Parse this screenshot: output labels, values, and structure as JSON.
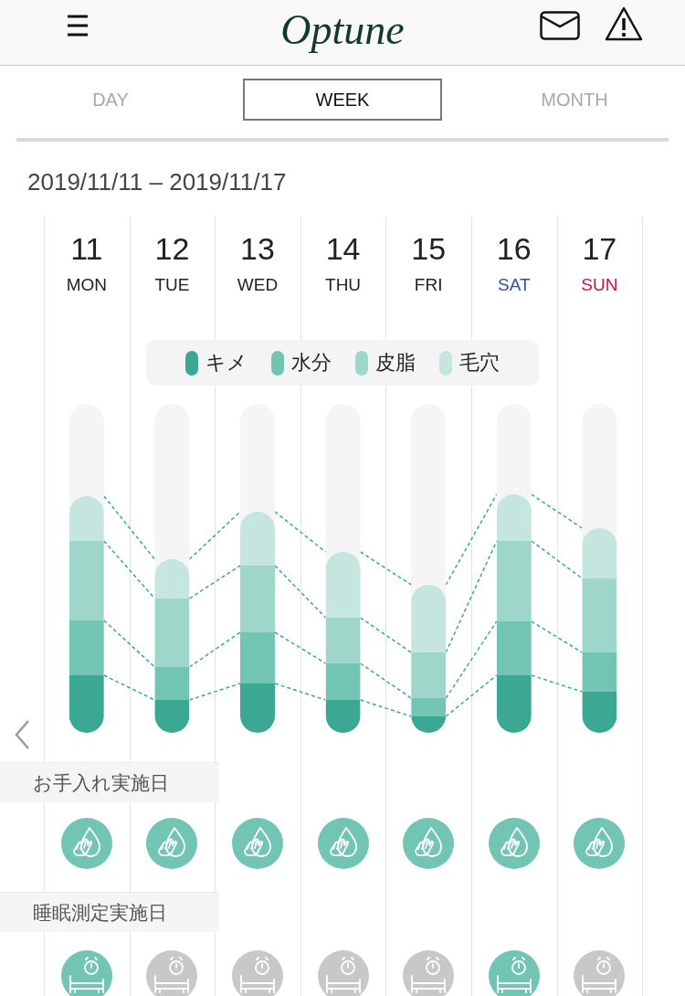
{
  "header": {
    "logo": "Optune"
  },
  "tabs": [
    {
      "label": "DAY",
      "selected": false
    },
    {
      "label": "WEEK",
      "selected": true
    },
    {
      "label": "MONTH",
      "selected": false
    }
  ],
  "date_range": "2019/11/11 – 2019/11/17",
  "days": [
    {
      "date": "11",
      "weekday": "MON",
      "kind": "weekday",
      "care_done": true,
      "sleep_done": true
    },
    {
      "date": "12",
      "weekday": "TUE",
      "kind": "weekday",
      "care_done": true,
      "sleep_done": false
    },
    {
      "date": "13",
      "weekday": "WED",
      "kind": "weekday",
      "care_done": true,
      "sleep_done": false
    },
    {
      "date": "14",
      "weekday": "THU",
      "kind": "weekday",
      "care_done": true,
      "sleep_done": false
    },
    {
      "date": "15",
      "weekday": "FRI",
      "kind": "weekday",
      "care_done": true,
      "sleep_done": false
    },
    {
      "date": "16",
      "weekday": "SAT",
      "kind": "saturday",
      "care_done": true,
      "sleep_done": true
    },
    {
      "date": "17",
      "weekday": "SUN",
      "kind": "sunday",
      "care_done": true,
      "sleep_done": false
    }
  ],
  "legend": [
    {
      "label": "キメ",
      "color": "#3aa893"
    },
    {
      "label": "水分",
      "color": "#72c4b3"
    },
    {
      "label": "皮脂",
      "color": "#9ed7ca"
    },
    {
      "label": "毛穴",
      "color": "#c4e6de"
    }
  ],
  "care_label": "お手入れ実施日",
  "sleep_label": "睡眠測定実施日"
}
